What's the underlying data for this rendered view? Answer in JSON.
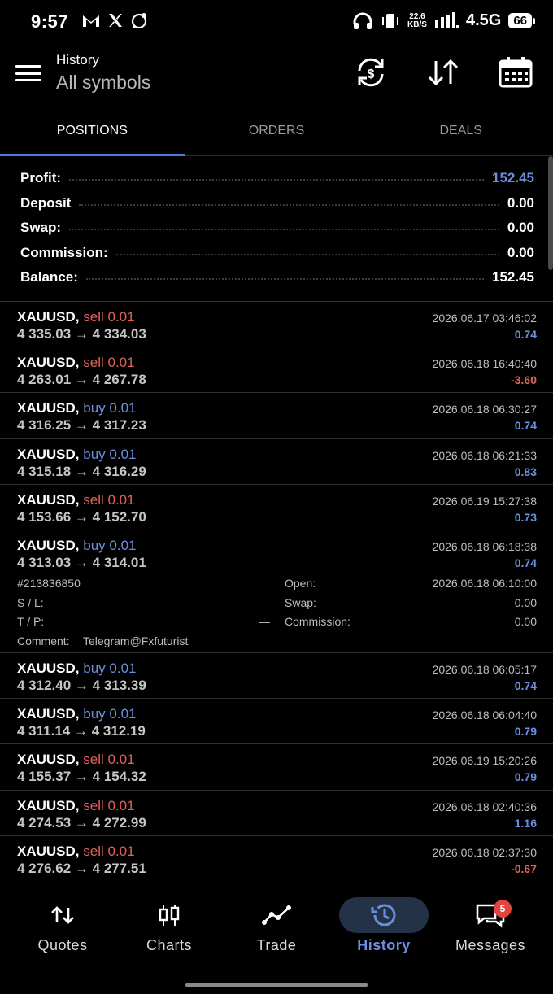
{
  "status": {
    "time": "9:57",
    "notif_icons": [
      "gmail-icon",
      "x-icon",
      "whatsapp-icon"
    ],
    "speed_top": "22.6",
    "speed_bottom": "KB/S",
    "network": "4.5G",
    "battery": "66"
  },
  "header": {
    "title": "History",
    "subtitle": "All symbols"
  },
  "tabs": [
    {
      "label": "POSITIONS",
      "active": true
    },
    {
      "label": "ORDERS",
      "active": false
    },
    {
      "label": "DEALS",
      "active": false
    }
  ],
  "summary": [
    {
      "label": "Profit:",
      "value": "152.45",
      "highlight": true
    },
    {
      "label": "Deposit",
      "value": "0.00",
      "highlight": false
    },
    {
      "label": "Swap:",
      "value": "0.00",
      "highlight": false
    },
    {
      "label": "Commission:",
      "value": "0.00",
      "highlight": false
    },
    {
      "label": "Balance:",
      "value": "152.45",
      "highlight": false
    }
  ],
  "trades": [
    {
      "symbol": "XAUUSD,",
      "side": "sell",
      "volume": "0.01",
      "open": "4 335.03",
      "close": "4 334.03",
      "time": "2026.06.17 03:46:02",
      "profit": "0.74"
    },
    {
      "symbol": "XAUUSD,",
      "side": "sell",
      "volume": "0.01",
      "open": "4 263.01",
      "close": "4 267.78",
      "time": "2026.06.18 16:40:40",
      "profit": "-3.60"
    },
    {
      "symbol": "XAUUSD,",
      "side": "buy",
      "volume": "0.01",
      "open": "4 316.25",
      "close": "4 317.23",
      "time": "2026.06.18 06:30:27",
      "profit": "0.74"
    },
    {
      "symbol": "XAUUSD,",
      "side": "buy",
      "volume": "0.01",
      "open": "4 315.18",
      "close": "4 316.29",
      "time": "2026.06.18 06:21:33",
      "profit": "0.83"
    },
    {
      "symbol": "XAUUSD,",
      "side": "sell",
      "volume": "0.01",
      "open": "4 153.66",
      "close": "4 152.70",
      "time": "2026.06.19 15:27:38",
      "profit": "0.73"
    },
    {
      "symbol": "XAUUSD,",
      "side": "buy",
      "volume": "0.01",
      "open": "4 313.03",
      "close": "4 314.01",
      "time": "2026.06.18 06:18:38",
      "profit": "0.74",
      "details": {
        "ticket": "#213836850",
        "sl_label": "S / L:",
        "sl_value": "—",
        "tp_label": "T / P:",
        "tp_value": "—",
        "comment_label": "Comment:",
        "comment_value": "Telegram@Fxfuturist",
        "open_label": "Open:",
        "open_value": "2026.06.18 06:10:00",
        "swap_label": "Swap:",
        "swap_value": "0.00",
        "commission_label": "Commission:",
        "commission_value": "0.00"
      }
    },
    {
      "symbol": "XAUUSD,",
      "side": "buy",
      "volume": "0.01",
      "open": "4 312.40",
      "close": "4 313.39",
      "time": "2026.06.18 06:05:17",
      "profit": "0.74"
    },
    {
      "symbol": "XAUUSD,",
      "side": "buy",
      "volume": "0.01",
      "open": "4 311.14",
      "close": "4 312.19",
      "time": "2026.06.18 06:04:40",
      "profit": "0.79"
    },
    {
      "symbol": "XAUUSD,",
      "side": "sell",
      "volume": "0.01",
      "open": "4 155.37",
      "close": "4 154.32",
      "time": "2026.06.19 15:20:26",
      "profit": "0.79"
    },
    {
      "symbol": "XAUUSD,",
      "side": "sell",
      "volume": "0.01",
      "open": "4 274.53",
      "close": "4 272.99",
      "time": "2026.06.18 02:40:36",
      "profit": "1.16"
    },
    {
      "symbol": "XAUUSD,",
      "side": "sell",
      "volume": "0.01",
      "open": "4 276.62",
      "close": "4 277.51",
      "time": "2026.06.18 02:37:30",
      "profit": "-0.67"
    }
  ],
  "nav": [
    {
      "label": "Quotes",
      "icon": "quotes-icon",
      "active": false
    },
    {
      "label": "Charts",
      "icon": "charts-icon",
      "active": false
    },
    {
      "label": "Trade",
      "icon": "trade-icon",
      "active": false
    },
    {
      "label": "History",
      "icon": "history-icon",
      "active": true
    },
    {
      "label": "Messages",
      "icon": "messages-icon",
      "active": false,
      "badge": "5"
    }
  ],
  "colors": {
    "accent": "#4b7ed8",
    "buy": "#6b8fe0",
    "sell": "#e0625a",
    "background": "#000000"
  }
}
